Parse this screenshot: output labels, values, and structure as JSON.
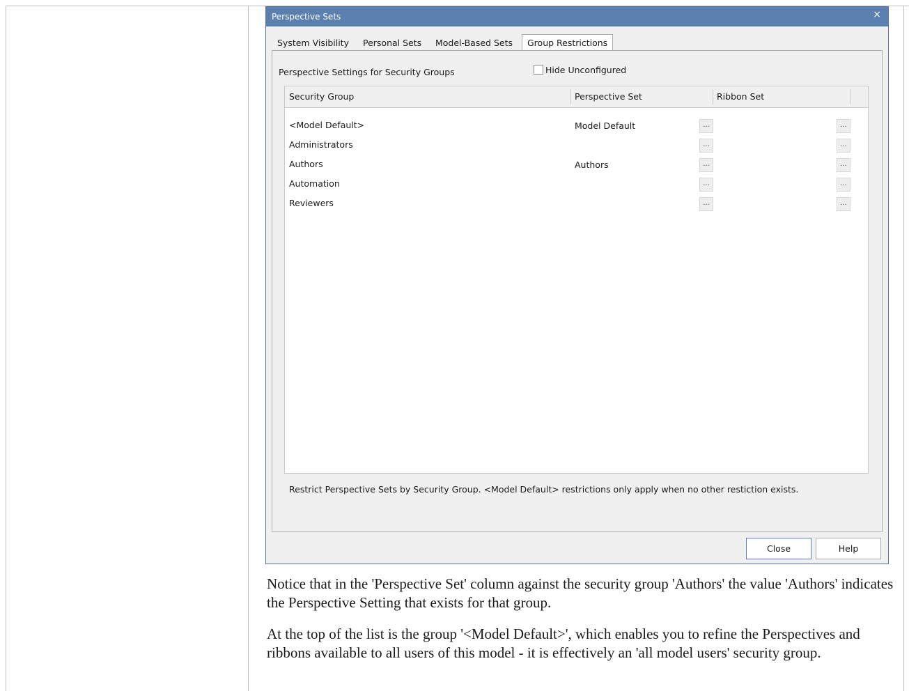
{
  "dialog": {
    "title": "Perspective Sets",
    "close_glyph": "×",
    "tabs": [
      {
        "label": "System Visibility",
        "active": false
      },
      {
        "label": "Personal Sets",
        "active": false
      },
      {
        "label": "Model-Based Sets",
        "active": false
      },
      {
        "label": "Group Restrictions",
        "active": true
      }
    ],
    "section_label": "Perspective Settings for Security Groups",
    "hide_unconfigured": {
      "label": "Hide Unconfigured",
      "checked": false
    },
    "grid": {
      "columns": [
        "Security Group",
        "Perspective Set",
        "Ribbon Set"
      ],
      "ellipsis": "...",
      "rows": [
        {
          "group": "<Model Default>",
          "perspective": "Model Default",
          "ribbon": ""
        },
        {
          "group": "Administrators",
          "perspective": "",
          "ribbon": ""
        },
        {
          "group": "Authors",
          "perspective": "Authors",
          "ribbon": ""
        },
        {
          "group": "Automation",
          "perspective": "",
          "ribbon": ""
        },
        {
          "group": "Reviewers",
          "perspective": "",
          "ribbon": ""
        }
      ]
    },
    "note": "Restrict Perspective Sets by Security Group. <Model Default> restrictions only apply when no other restiction exists.",
    "buttons": {
      "close": "Close",
      "help": "Help"
    }
  },
  "body_text": {
    "paragraph1": "Notice that in the 'Perspective Set' column against the security group 'Authors' the value 'Authors' indicates the Perspective Setting that exists for that group.",
    "paragraph2": "At the top of the list is the group '<Model Default>', which enables you to refine the Perspectives and ribbons available to all users of this model - it is effectively an 'all model users' security group."
  }
}
